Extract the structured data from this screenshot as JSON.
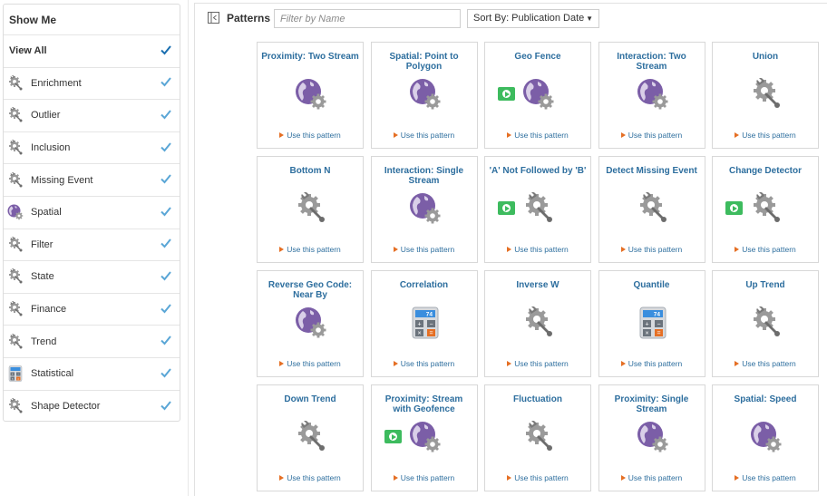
{
  "sidebar": {
    "title": "Show Me",
    "items": [
      {
        "label": "View All",
        "icon": "view-all",
        "checked": true
      },
      {
        "label": "Enrichment",
        "icon": "gear-wrench-icon",
        "checked": true
      },
      {
        "label": "Outlier",
        "icon": "gear-wrench-icon",
        "checked": true
      },
      {
        "label": "Inclusion",
        "icon": "gear-wrench-icon",
        "checked": true
      },
      {
        "label": "Missing Event",
        "icon": "gear-wrench-icon",
        "checked": true
      },
      {
        "label": "Spatial",
        "icon": "globe-gear-icon",
        "checked": true
      },
      {
        "label": "Filter",
        "icon": "gear-wrench-icon",
        "checked": true
      },
      {
        "label": "State",
        "icon": "gear-wrench-icon",
        "checked": true
      },
      {
        "label": "Finance",
        "icon": "gear-wrench-icon",
        "checked": true
      },
      {
        "label": "Trend",
        "icon": "gear-wrench-icon",
        "checked": true
      },
      {
        "label": "Statistical",
        "icon": "calculator-icon",
        "checked": true
      },
      {
        "label": "Shape Detector",
        "icon": "gear-wrench-icon",
        "checked": true
      }
    ]
  },
  "toolbar": {
    "title": "Patterns",
    "filter_placeholder": "Filter by Name",
    "sort_label": "Sort By: Publication Date"
  },
  "use_link_label": "Use this pattern",
  "calculator_display": "74",
  "colors": {
    "accent_blue": "#2d6e9e",
    "link_arrow": "#e56f24",
    "check": "#5aa6d6",
    "play": "#3dbb5e",
    "globe": "#7b5ea7"
  },
  "patterns": [
    {
      "title": "Proximity: Two Stream",
      "icon": "globe",
      "play": false
    },
    {
      "title": "Spatial: Point to Polygon",
      "icon": "globe",
      "play": false
    },
    {
      "title": "Geo Fence",
      "icon": "globe",
      "play": true
    },
    {
      "title": "Interaction: Two Stream",
      "icon": "globe",
      "play": false
    },
    {
      "title": "Union",
      "icon": "gear",
      "play": false
    },
    {
      "title": "Bottom N",
      "icon": "gear",
      "play": false
    },
    {
      "title": "Interaction: Single Stream",
      "icon": "globe",
      "play": false
    },
    {
      "title": "'A' Not Followed by 'B'",
      "icon": "gear",
      "play": true
    },
    {
      "title": "Detect Missing Event",
      "icon": "gear",
      "play": false
    },
    {
      "title": "Change Detector",
      "icon": "gear",
      "play": true
    },
    {
      "title": "Reverse Geo Code: Near By",
      "icon": "globe",
      "play": false
    },
    {
      "title": "Correlation",
      "icon": "calc",
      "play": false
    },
    {
      "title": "Inverse W",
      "icon": "gear",
      "play": false
    },
    {
      "title": "Quantile",
      "icon": "calc",
      "play": false
    },
    {
      "title": "Up Trend",
      "icon": "gear",
      "play": false
    },
    {
      "title": "Down Trend",
      "icon": "gear",
      "play": false
    },
    {
      "title": "Proximity: Stream with Geofence",
      "icon": "globe",
      "play": true
    },
    {
      "title": "Fluctuation",
      "icon": "gear",
      "play": false
    },
    {
      "title": "Proximity: Single Stream",
      "icon": "globe",
      "play": false
    },
    {
      "title": "Spatial: Speed",
      "icon": "globe",
      "play": false
    }
  ]
}
